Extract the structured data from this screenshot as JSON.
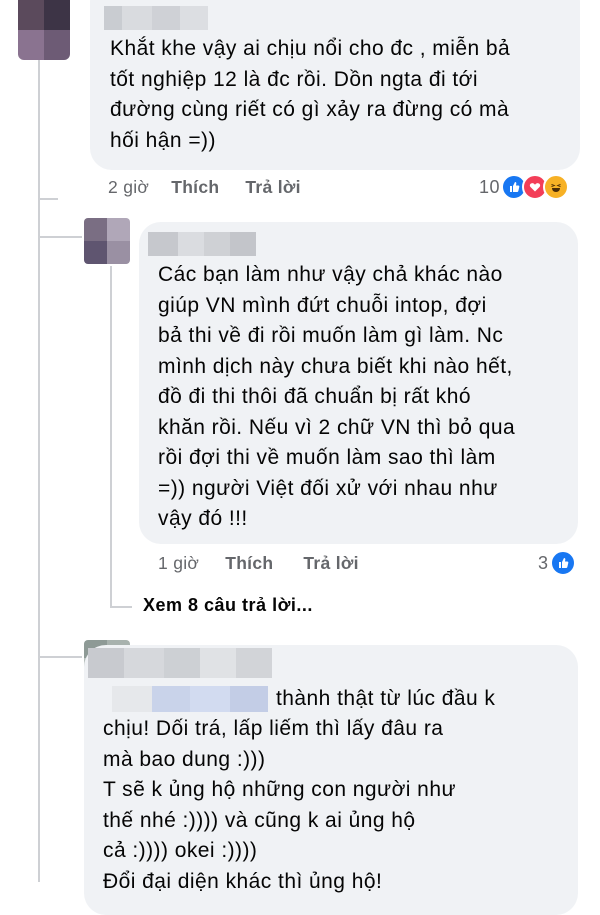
{
  "comments": [
    {
      "text": "Khắt khe vậy ai chịu nổi cho đc , miễn bả\ntốt nghiệp 12 là đc rồi. Dồn ngta đi tới\nđường cùng riết có gì xảy ra đừng có mà\nhối hận =))",
      "time": "2 giờ",
      "like": "Thích",
      "reply": "Trả lời",
      "reaction_count": "10",
      "reactions": [
        "like-icon",
        "love-icon",
        "haha-icon"
      ]
    },
    {
      "text": "Các bạn làm như vậy chả khác nào\ngiúp VN mình đứt chuỗi intop, đợi\nbả thi về đi rồi muốn làm gì làm. Nc\nmình dịch này chưa biết khi nào hết,\nđồ đi thi thôi đã chuẩn bị rất khó\nkhăn rồi. Nếu vì 2 chữ VN thì bỏ qua\nrồi đợi thi về muốn làm sao thì làm\n=)) người Việt đối xử với nhau như\nvậy đó !!!",
      "time": "1 giờ",
      "like": "Thích",
      "reply": "Trả lời",
      "reaction_count": "3",
      "reactions": [
        "like-icon"
      ]
    }
  ],
  "view_more": "Xem 8 câu trả lời...",
  "third_comment": {
    "first_line": "thành thật từ lúc đầu k",
    "text": "chịu! Dối trá, lấp liếm thì lấy đâu ra\nmà bao dung :)))\nT sẽ k ủng hộ những con người như\nthế nhé :)))) và cũng k ai ủng hộ\ncả :)))) okei :))))\nĐổi đại diện khác thì ủng hộ!"
  },
  "colors": {
    "bubble": "#f0f2f5",
    "meta": "#65676b",
    "like_blue": "#1877f2",
    "love_red": "#f33e58",
    "haha_yellow": "#f7b125"
  }
}
